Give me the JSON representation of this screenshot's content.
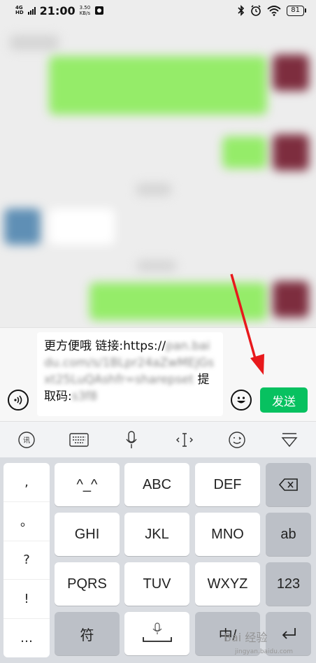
{
  "status_bar": {
    "network": "4G",
    "network_sub": "HD",
    "time": "21:00",
    "speed_value": "3.50",
    "speed_unit": "KB/s",
    "battery": "81"
  },
  "input_bar": {
    "message_prefix": "更方便哦 链接:https://",
    "message_url": "pan.baidu.com/s/1BLpr24aZwMEjGsxt25LuQAshfr=sharepset",
    "message_suffix": " 提取码:",
    "message_code": "s3f8",
    "send_label": "发送"
  },
  "keyboard": {
    "punctuation": [
      ",",
      "。",
      "?",
      "!",
      "…"
    ],
    "keys": {
      "row1": [
        "^_^",
        "ABC",
        "DEF"
      ],
      "row2": [
        "GHI",
        "JKL",
        "MNO"
      ],
      "row3": [
        "PQRS",
        "TUV",
        "WXYZ"
      ],
      "ab": "ab",
      "num": "123",
      "symbol": "符",
      "lang": "中/"
    },
    "toolbar_icons": [
      "handwriting-icon",
      "keyboard-icon",
      "microphone-icon",
      "cursor-icon",
      "emoji-icon",
      "collapse-keyboard-icon"
    ]
  },
  "watermark": {
    "text": "Bai 经验",
    "sub": "jingyan.baidu.com"
  }
}
